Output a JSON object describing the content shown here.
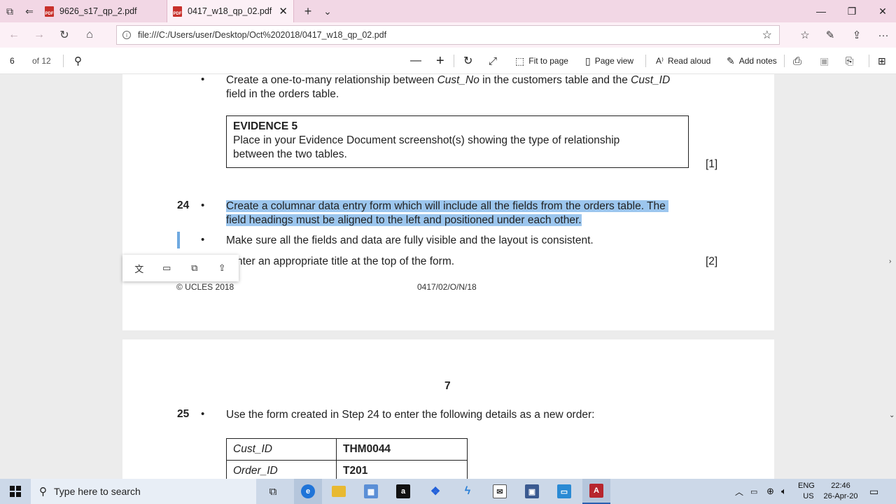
{
  "browser": {
    "tabs": [
      {
        "title": "9626_s17_qp_2.pdf",
        "icon": "pdf-icon",
        "active": false
      },
      {
        "title": "0417_w18_qp_02.pdf",
        "icon": "pdf-icon",
        "active": true
      }
    ],
    "url": "file:///C:/Users/user/Desktop/Oct%202018/0417_w18_qp_02.pdf"
  },
  "pdf_toolbar": {
    "current_page": "6",
    "page_count": "of 12",
    "fit_to_page": "Fit to page",
    "page_view": "Page view",
    "read_aloud": "Read aloud",
    "add_notes": "Add notes"
  },
  "page6": {
    "bullet_line1a": "Create a one-to-many relationship between ",
    "cust_no": "Cust_No",
    "bullet_line1b": " in the customers table and the ",
    "cust_id": "Cust_ID",
    "bullet_line2": "field in the orders table.",
    "evidence_title": "EVIDENCE 5",
    "evidence_line1": "Place in your Evidence Document screenshot(s) showing the type of relationship",
    "evidence_line2": "between the two tables.",
    "mark1": "[1]",
    "q24_number": "24",
    "q24_line1": "Create a columnar data entry form which will include all the fields from the orders table. The",
    "q24_line2": "field headings must be aligned to the left and positioned under each other.",
    "q24_bullet2": "Make sure all the fields and data are fully visible and the layout is consistent.",
    "q24_bullet3": "nter an appropriate title at the top of the form.",
    "mark2": "[2]",
    "copyright": "© UCLES 2018",
    "paper_code": "0417/02/O/N/18"
  },
  "page7": {
    "page_number": "7",
    "q25_number": "25",
    "q25_text": "Use the form created in Step 24 to enter the following details as a new order:",
    "table": [
      {
        "field": "Cust_ID",
        "value": "THM0044"
      },
      {
        "field": "Order_ID",
        "value": "T201"
      }
    ]
  },
  "taskbar": {
    "search_placeholder": "Type here to search",
    "lang_top": "ENG",
    "lang_bottom": "US",
    "time": "22:46",
    "date": "26-Apr-20"
  },
  "colors": {
    "tab_bar": "#f2d7e5",
    "highlight": "#9cc6ee",
    "taskbar": "#ccd8e8"
  }
}
